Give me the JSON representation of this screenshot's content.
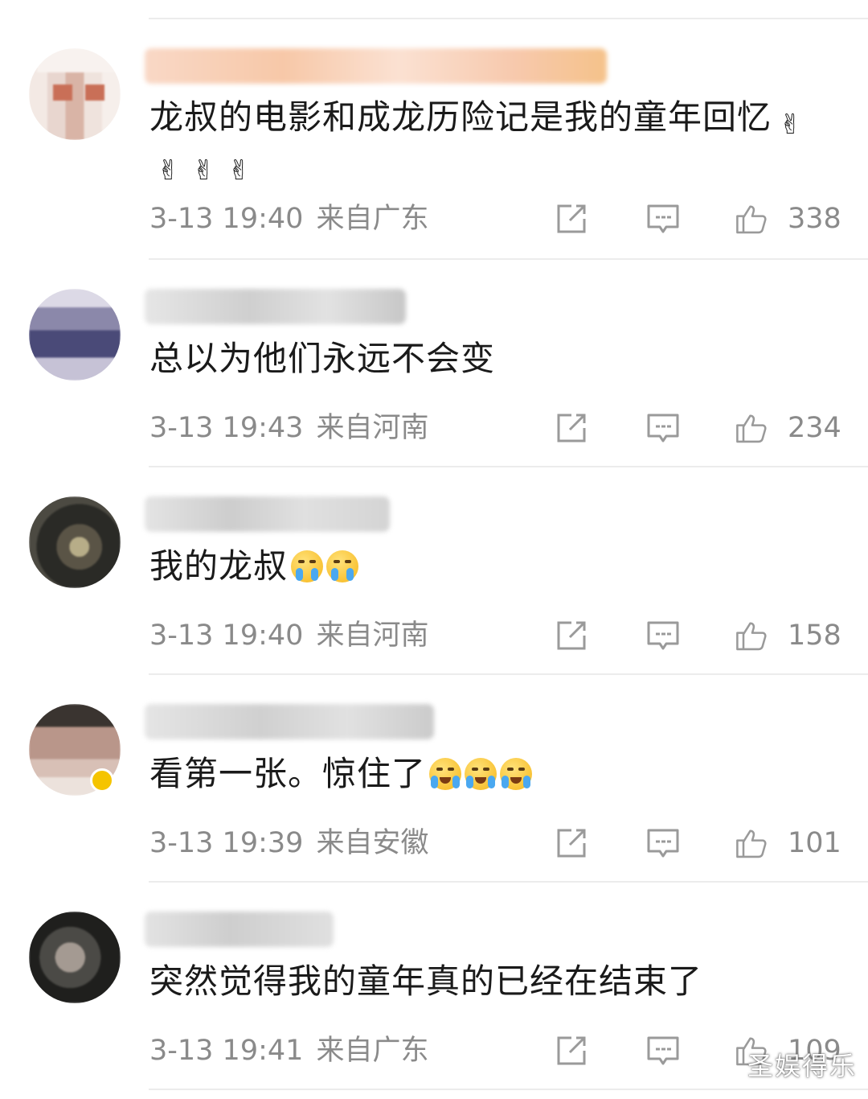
{
  "comments": [
    {
      "text": "龙叔的电影和成龙历险记是我的童年回忆",
      "emoji": "✌",
      "emoji_name": "victory-hand",
      "emoji_count": 4,
      "time": "3-13 19:40",
      "location": "来自广东",
      "likes": "338"
    },
    {
      "text": "总以为他们永远不会变",
      "time": "3-13 19:43",
      "location": "来自河南",
      "likes": "234"
    },
    {
      "text": "我的龙叔",
      "emoji_name": "crying-face",
      "emoji_count": 2,
      "time": "3-13 19:40",
      "location": "来自河南",
      "likes": "158"
    },
    {
      "text": "看第一张。惊住了",
      "emoji_name": "laugh-cry-face",
      "emoji_count": 3,
      "time": "3-13 19:39",
      "location": "来自安徽",
      "likes": "101"
    },
    {
      "text": "突然觉得我的童年真的已经在结束了",
      "time": "3-13 19:41",
      "location": "来自广东",
      "likes": "109"
    }
  ],
  "watermark": "圣娱得乐",
  "colors": {
    "text": "#1a1a1a",
    "meta": "#8a8a8a",
    "divider": "#ececec",
    "icon": "#9a9a9a"
  }
}
